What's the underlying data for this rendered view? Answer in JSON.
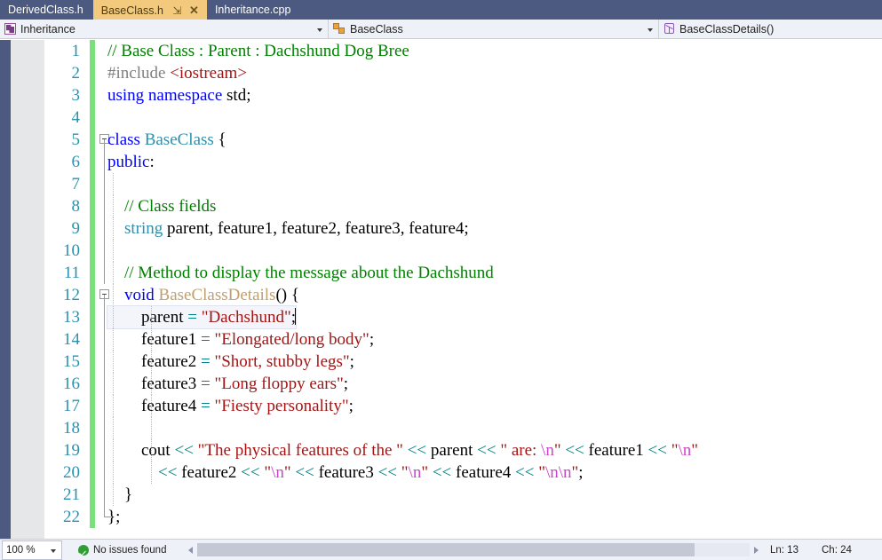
{
  "tabs": [
    {
      "label": "DerivedClass.h",
      "active": false,
      "pin": "",
      "close": ""
    },
    {
      "label": "BaseClass.h",
      "active": true,
      "pin": "⇲",
      "close": "✕"
    },
    {
      "label": "Inheritance.cpp",
      "active": false,
      "pin": "",
      "close": ""
    }
  ],
  "navbar": {
    "project": "Inheritance",
    "project_icon": "project-icon",
    "class": "BaseClass",
    "class_icon": "class-icon",
    "member": "BaseClassDetails()",
    "member_icon": "method-icon"
  },
  "statusbar": {
    "zoom": "100 %",
    "issues": "No issues found",
    "line_label": "Ln: 13",
    "col_label": "Ch: 24"
  },
  "editor": {
    "current_line": 13,
    "lines": [
      {
        "n": "1",
        "tokens": [
          {
            "t": "comment",
            "v": "// Base Class : Parent : Dachshund Dog Bree"
          }
        ]
      },
      {
        "n": "2",
        "tokens": [
          {
            "t": "pp",
            "v": "#include "
          },
          {
            "t": "str",
            "v": "<iostream>"
          }
        ]
      },
      {
        "n": "3",
        "tokens": [
          {
            "t": "key",
            "v": "using namespace "
          },
          {
            "t": "plain",
            "v": "std;"
          }
        ]
      },
      {
        "n": "4",
        "tokens": []
      },
      {
        "n": "5",
        "tokens": [
          {
            "t": "key",
            "v": "class "
          },
          {
            "t": "class",
            "v": "BaseClass"
          },
          {
            "t": "plain",
            "v": " {"
          }
        ]
      },
      {
        "n": "6",
        "tokens": [
          {
            "t": "key",
            "v": "public"
          },
          {
            "t": "plain",
            "v": ":"
          }
        ]
      },
      {
        "n": "7",
        "tokens": []
      },
      {
        "n": "8",
        "tokens": [
          {
            "t": "comment",
            "v": "    // Class fields"
          }
        ]
      },
      {
        "n": "9",
        "tokens": [
          {
            "t": "type",
            "v": "    string "
          },
          {
            "t": "plain",
            "v": "parent, feature1, feature2, feature3, feature4;"
          }
        ]
      },
      {
        "n": "10",
        "tokens": []
      },
      {
        "n": "11",
        "tokens": [
          {
            "t": "comment",
            "v": "    // Method to display the message about the Dachshund"
          }
        ]
      },
      {
        "n": "12",
        "tokens": [
          {
            "t": "key",
            "v": "    void "
          },
          {
            "t": "method",
            "v": "BaseClassDetails"
          },
          {
            "t": "plain",
            "v": "() {"
          }
        ]
      },
      {
        "n": "13",
        "tokens": [
          {
            "t": "plain",
            "v": "        parent "
          },
          {
            "t": "op",
            "v": "= "
          },
          {
            "t": "str",
            "v": "\"Dachshund\""
          },
          {
            "t": "plain",
            "v": ";"
          }
        ]
      },
      {
        "n": "14",
        "tokens": [
          {
            "t": "plain",
            "v": "        feature1 "
          },
          {
            "t": "op",
            "v": "= "
          },
          {
            "t": "str",
            "v": "\"Elongated/long body\""
          },
          {
            "t": "plain",
            "v": ";"
          }
        ]
      },
      {
        "n": "15",
        "tokens": [
          {
            "t": "plain",
            "v": "        feature2 "
          },
          {
            "t": "op",
            "v": "= "
          },
          {
            "t": "str",
            "v": "\"Short, stubby legs\""
          },
          {
            "t": "plain",
            "v": ";"
          }
        ]
      },
      {
        "n": "16",
        "tokens": [
          {
            "t": "plain",
            "v": "        feature3 "
          },
          {
            "t": "op",
            "v": "= "
          },
          {
            "t": "str",
            "v": "\"Long floppy ears\""
          },
          {
            "t": "plain",
            "v": ";"
          }
        ]
      },
      {
        "n": "17",
        "tokens": [
          {
            "t": "plain",
            "v": "        feature4 "
          },
          {
            "t": "op",
            "v": "= "
          },
          {
            "t": "str",
            "v": "\"Fiesty personality\""
          },
          {
            "t": "plain",
            "v": ";"
          }
        ]
      },
      {
        "n": "18",
        "tokens": []
      },
      {
        "n": "19",
        "tokens": [
          {
            "t": "plain",
            "v": "        cout "
          },
          {
            "t": "op",
            "v": "<< "
          },
          {
            "t": "str",
            "v": "\"The physical features of the \""
          },
          {
            "t": "plain",
            "v": " "
          },
          {
            "t": "op",
            "v": "<< "
          },
          {
            "t": "plain",
            "v": "parent "
          },
          {
            "t": "op",
            "v": "<< "
          },
          {
            "t": "str",
            "v": "\" are: "
          },
          {
            "t": "esc",
            "v": "\\n"
          },
          {
            "t": "str",
            "v": "\""
          },
          {
            "t": "plain",
            "v": " "
          },
          {
            "t": "op",
            "v": "<< "
          },
          {
            "t": "plain",
            "v": "feature1 "
          },
          {
            "t": "op",
            "v": "<< "
          },
          {
            "t": "str",
            "v": "\""
          },
          {
            "t": "esc",
            "v": "\\n"
          },
          {
            "t": "str",
            "v": "\""
          }
        ]
      },
      {
        "n": "20",
        "tokens": [
          {
            "t": "plain",
            "v": "            "
          },
          {
            "t": "op",
            "v": "<< "
          },
          {
            "t": "plain",
            "v": "feature2 "
          },
          {
            "t": "op",
            "v": "<< "
          },
          {
            "t": "str",
            "v": "\""
          },
          {
            "t": "esc",
            "v": "\\n"
          },
          {
            "t": "str",
            "v": "\""
          },
          {
            "t": "plain",
            "v": " "
          },
          {
            "t": "op",
            "v": "<< "
          },
          {
            "t": "plain",
            "v": "feature3 "
          },
          {
            "t": "op",
            "v": "<< "
          },
          {
            "t": "str",
            "v": "\""
          },
          {
            "t": "esc",
            "v": "\\n"
          },
          {
            "t": "str",
            "v": "\""
          },
          {
            "t": "plain",
            "v": " "
          },
          {
            "t": "op",
            "v": "<< "
          },
          {
            "t": "plain",
            "v": "feature4 "
          },
          {
            "t": "op",
            "v": "<< "
          },
          {
            "t": "str",
            "v": "\""
          },
          {
            "t": "esc",
            "v": "\\n\\n"
          },
          {
            "t": "str",
            "v": "\""
          },
          {
            "t": "plain",
            "v": ";"
          }
        ]
      },
      {
        "n": "21",
        "tokens": [
          {
            "t": "plain",
            "v": "    }"
          }
        ]
      },
      {
        "n": "22",
        "tokens": [
          {
            "t": "plain",
            "v": "};"
          }
        ]
      }
    ]
  },
  "colors": {
    "chrome": "#4c5a81",
    "active_tab": "#f2c97d",
    "navbar_bg": "#eef1f8",
    "changebar": "#79e07a",
    "comment": "#008000",
    "string": "#a31515",
    "keyword": "#0000ff",
    "type": "#2b91af",
    "method": "#c2a06b",
    "operator": "#008080",
    "escape": "#cc44cc"
  }
}
